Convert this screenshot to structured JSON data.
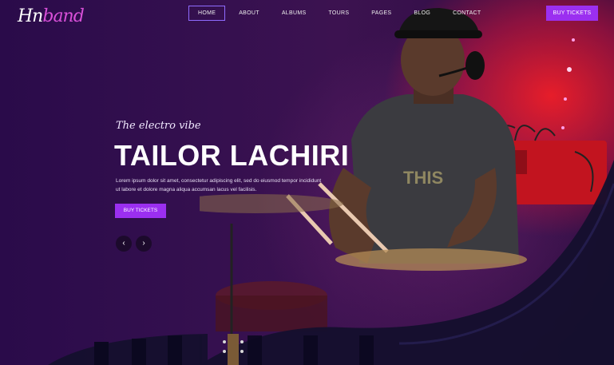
{
  "brand": {
    "logo_main": "Hn",
    "logo_accent": "band"
  },
  "nav": {
    "items": [
      "HOME",
      "ABOUT",
      "ALBUMS",
      "TOURS",
      "PAGES",
      "BLOG",
      "CONTACT"
    ],
    "active": "HOME"
  },
  "header": {
    "cta_label": "BUY TICKETS"
  },
  "hero": {
    "tagline": "The electro vibe",
    "headline": "TAILOR LACHIRI",
    "description": "Lorem ipsum dolor sit amet, consectetur adipiscing elit, sed do eiusmod tempor incididunt ut labore et dolore magna aliqua accumsan lacus vel facilisis.",
    "cta_label": "BUY TICKETS",
    "prev_icon": "‹",
    "next_icon": "›"
  },
  "colors": {
    "accent": "#9b2ff0",
    "background": "#2a0b4a",
    "stage_red": "#e01e2a",
    "wave_dark": "#1a0f3a"
  }
}
